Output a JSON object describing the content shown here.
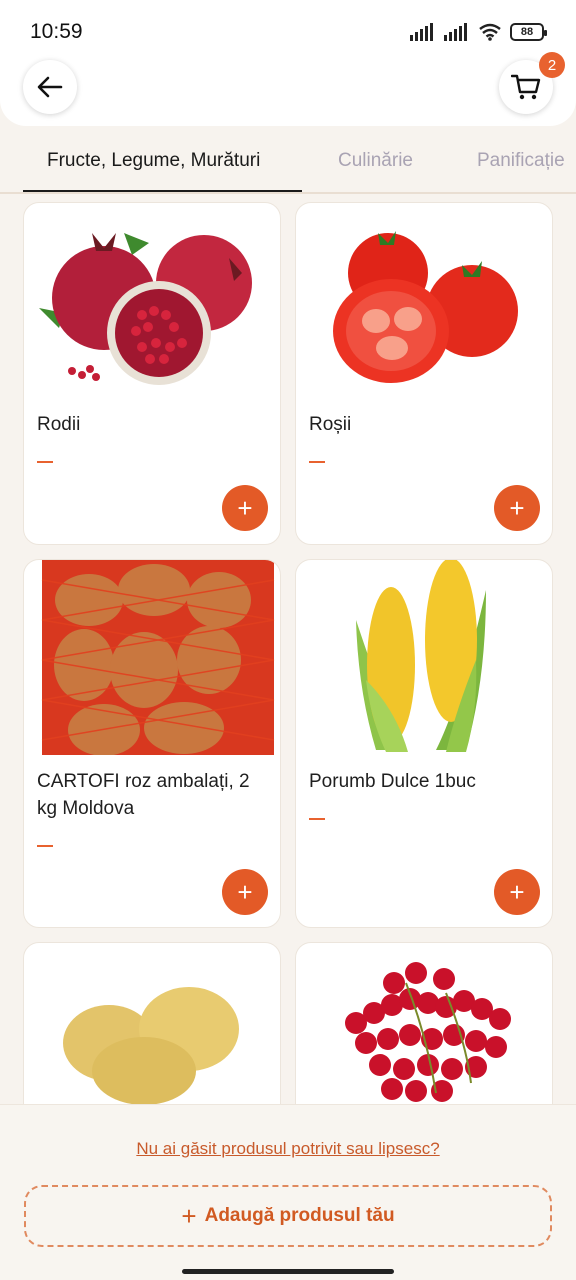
{
  "status": {
    "time": "10:59",
    "battery": "88"
  },
  "header": {
    "cart_count": "2"
  },
  "tabs": [
    {
      "label": "Fructe, Legume, Murături"
    },
    {
      "label": "Culinărie"
    },
    {
      "label": "Panificație"
    }
  ],
  "products": [
    {
      "name": "Rodii",
      "price": "—",
      "image": "pomegranate"
    },
    {
      "name": "Roșii",
      "price": "—",
      "image": "tomatoes"
    },
    {
      "name": "CARTOFI roz ambalați, 2 kg Moldova",
      "price": "—",
      "image": "potato-sack"
    },
    {
      "name": "Porumb Dulce 1buc",
      "price": "—",
      "image": "corn"
    },
    {
      "name": "",
      "price": "",
      "image": "potatoes"
    },
    {
      "name": "",
      "price": "",
      "image": "red-currants"
    }
  ],
  "footer": {
    "missing_link": "Nu ai găsit produsul potrivit sau lipsesc?",
    "add_own_label": "Adaugă produsul tău"
  },
  "colors": {
    "accent": "#e35a27",
    "background": "#f7f3ee"
  }
}
